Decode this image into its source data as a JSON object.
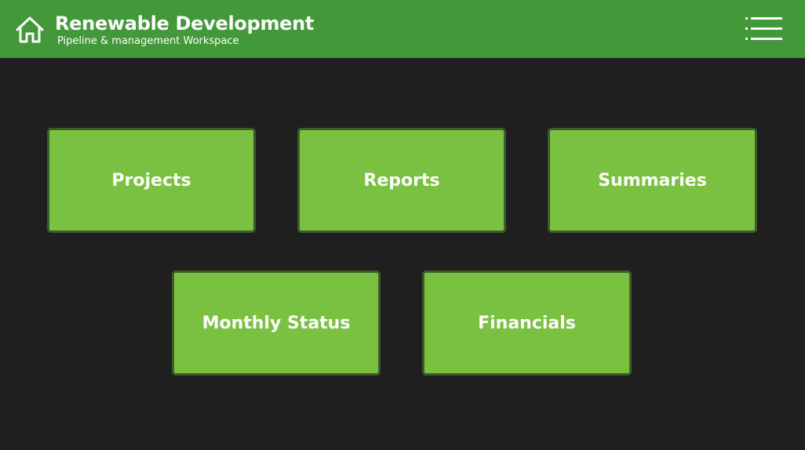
{
  "header": {
    "title": "Renewable Development",
    "subtitle": "Pipeline & management Workspace",
    "home_icon": "home-icon",
    "menu_icon": "hamburger-menu-icon"
  },
  "tiles": [
    {
      "label": "Projects"
    },
    {
      "label": "Reports"
    },
    {
      "label": "Summaries"
    },
    {
      "label": "Monthly Status"
    },
    {
      "label": "Financials"
    }
  ],
  "colors": {
    "header_bg": "#43993a",
    "page_bg": "#1f1f1f",
    "tile_bg": "#7ac142",
    "tile_border": "#3c5c2a",
    "text": "#ffffff"
  }
}
